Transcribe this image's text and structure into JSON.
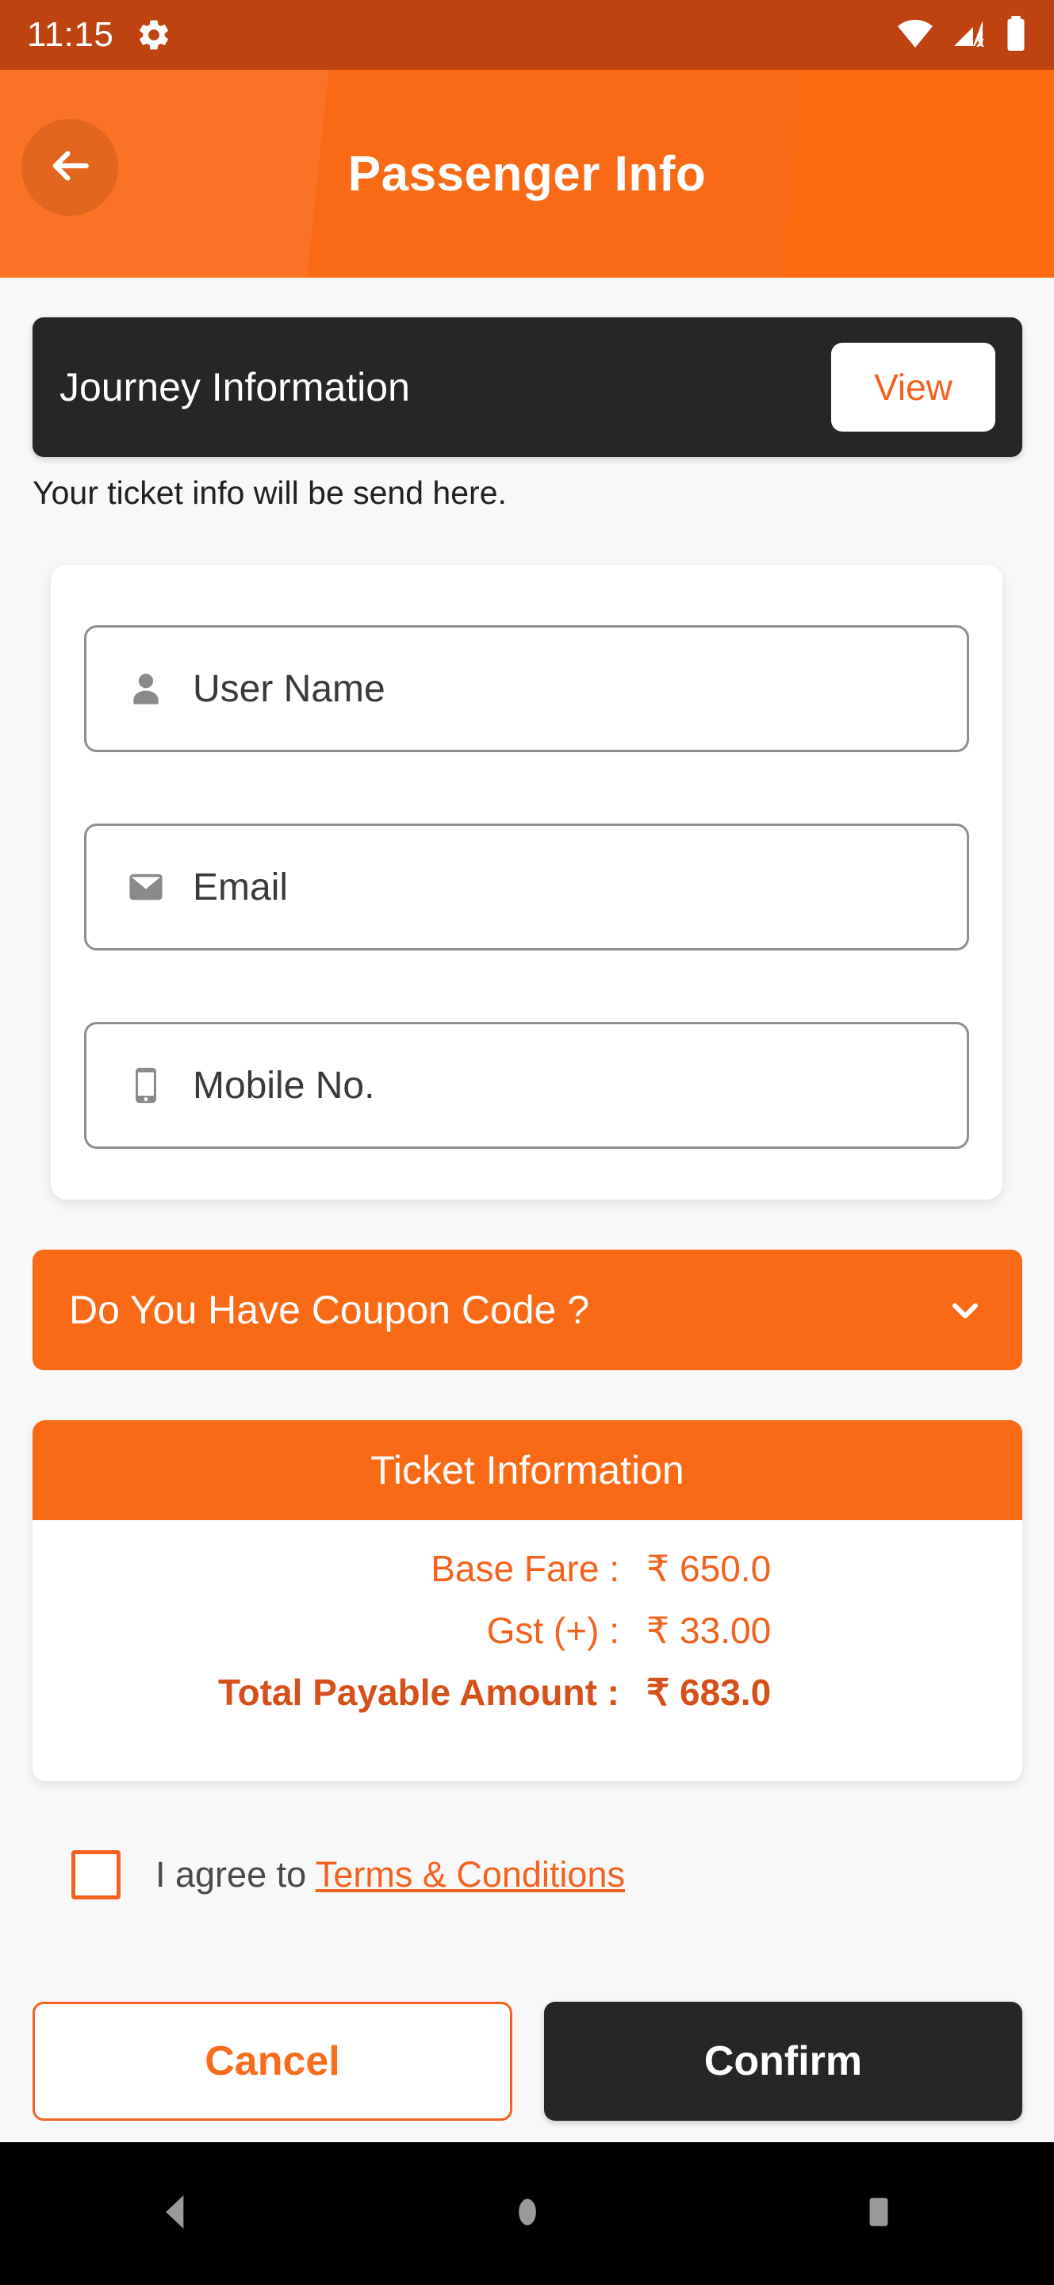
{
  "statusbar": {
    "time": "11:15",
    "icons": [
      "gear-icon",
      "wifi-icon",
      "cellular-off-icon",
      "battery-icon"
    ]
  },
  "header": {
    "title": "Passenger Info",
    "back_icon": "arrow-left-icon"
  },
  "journey": {
    "title": "Journey Information",
    "view_label": "View",
    "subtitle": "Your ticket info will be send here."
  },
  "form": {
    "fields": [
      {
        "icon": "person-icon",
        "placeholder": "User Name",
        "value": ""
      },
      {
        "icon": "envelope-icon",
        "placeholder": "Email",
        "value": ""
      },
      {
        "icon": "smartphone-icon",
        "placeholder": "Mobile No.",
        "value": ""
      }
    ]
  },
  "coupon": {
    "label": "Do You Have Coupon Code ?",
    "chevron": "chevron-down-icon",
    "expanded": false
  },
  "ticket": {
    "heading": "Ticket Information",
    "rows": [
      {
        "label": "Base Fare :",
        "value": "₹ 650.0"
      },
      {
        "label": "Gst (+) :",
        "value": "₹ 33.00"
      },
      {
        "label": "Total Payable Amount :",
        "value": "₹ 683.0"
      }
    ]
  },
  "terms": {
    "checked": false,
    "prefix": "I agree to ",
    "link": "Terms & Conditions"
  },
  "actions": {
    "cancel_label": "Cancel",
    "confirm_label": "Confirm"
  },
  "navbar": {
    "back": "nav-back-icon",
    "home": "nav-home-icon",
    "recents": "nav-recents-icon"
  },
  "colors": {
    "accent": "#f96a16",
    "accent_text": "#f4621f",
    "accent_dark": "#d6501a",
    "statusbar": "#bf4310",
    "dark_card": "#262626",
    "page_bg": "#f8f8f8"
  }
}
